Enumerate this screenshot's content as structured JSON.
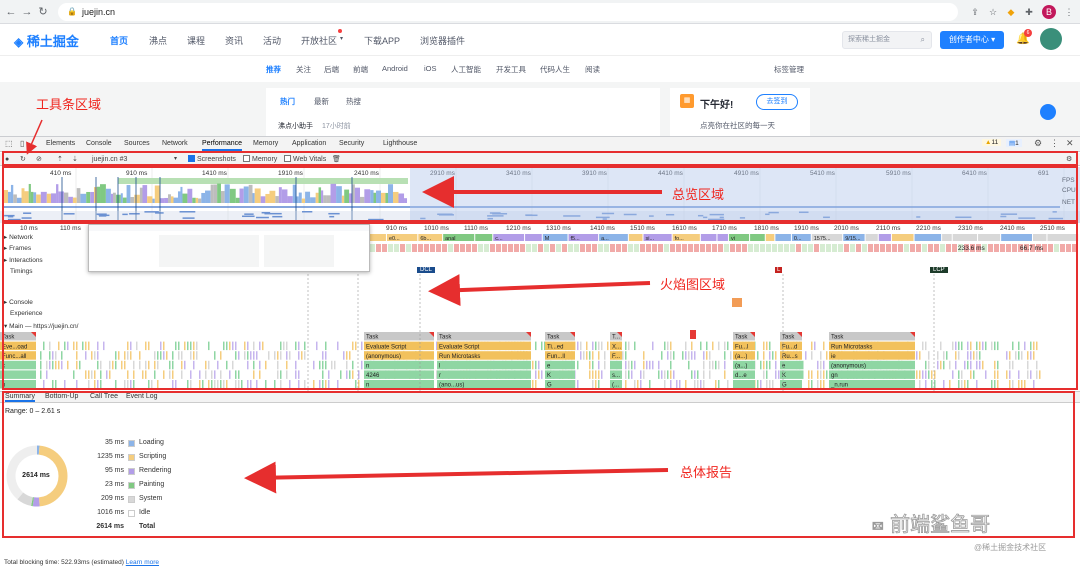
{
  "browser": {
    "url": "juejin.cn"
  },
  "site": {
    "logo": "稀土掘金",
    "nav": [
      "首页",
      "沸点",
      "课程",
      "资讯",
      "活动",
      "开放社区",
      "下载APP",
      "浏览器插件"
    ],
    "search_placeholder": "探索稀土掘金",
    "create_button": "创作者中心",
    "subnav": [
      "推荐",
      "关注",
      "后端",
      "前端",
      "Android",
      "iOS",
      "人工智能",
      "开发工具",
      "代码人生",
      "阅读"
    ],
    "tag_manage": "标签管理",
    "feed_tabs": [
      "热门",
      "最新",
      "热搜"
    ],
    "feed_author": "沸点小助手",
    "feed_time": "17小时前",
    "greeting": "下午好!",
    "checkin_button": "去签到",
    "greeting_sub": "点亮你在社区的每一天",
    "notification_count": "6"
  },
  "devtools": {
    "tabs": [
      "Elements",
      "Console",
      "Sources",
      "Network",
      "Performance",
      "Memory",
      "Application",
      "Security",
      "Lighthouse"
    ],
    "active_tab": "Performance",
    "warnings": "11",
    "messages": "1",
    "toolbar": {
      "profile_select": "juejin.cn #3",
      "screenshots": "Screenshots",
      "memory": "Memory",
      "web_vitals": "Web Vitals"
    },
    "overview": {
      "ticks": [
        "410 ms",
        "910 ms",
        "1410 ms",
        "1910 ms",
        "2410 ms",
        "2910 ms",
        "3410 ms",
        "3910 ms",
        "4410 ms",
        "4910 ms",
        "5410 ms",
        "5910 ms",
        "6410 ms",
        "691"
      ],
      "lanes": [
        "FPS",
        "CPU",
        "NET"
      ]
    },
    "flame": {
      "ticks": [
        "10 ms",
        "110 ms",
        "910 ms",
        "1010 ms",
        "1110 ms",
        "1210 ms",
        "1310 ms",
        "1410 ms",
        "1510 ms",
        "1610 ms",
        "1710 ms",
        "1810 ms",
        "1910 ms",
        "2010 ms",
        "2110 ms",
        "2210 ms",
        "2310 ms",
        "2410 ms",
        "2510 ms"
      ],
      "tracks": [
        "Network",
        "Frames",
        "Interactions",
        "Timings",
        "Console",
        "Experience",
        "Main — https://juejin.cn/"
      ],
      "frame_times": [
        "233.6 ms",
        "66.7 ms"
      ],
      "markers": [
        "DCL",
        "L",
        "LCP"
      ],
      "network_labels": [
        "e0...",
        "6b...",
        "anal",
        "c...",
        "M",
        "f5...",
        "a...",
        "si...",
        "fo...",
        "vi",
        "0...",
        "1575...",
        "9/15..."
      ],
      "main_rows": [
        [
          "Task",
          "Task",
          "Task",
          "Task",
          "T...",
          "Task",
          "Task",
          "Task"
        ],
        [
          "Eve...oad",
          "Evaluate Script",
          "Evaluate Script",
          "Ti...ed",
          "X...",
          "Fu...l",
          "Fu...d",
          "Run Microtasks"
        ],
        [
          "Func...all",
          "(anonymous)",
          "Run Microtasks",
          "Fun...ll",
          "F...",
          "(a...)",
          "Ru...s",
          "ie"
        ],
        [
          "c",
          "n",
          "l",
          "e",
          "",
          "(a...)",
          "e",
          "(anonymous)"
        ],
        [
          "f",
          "4246",
          "r",
          "K",
          "s...",
          "d...e",
          "K",
          "gn"
        ],
        [
          "n",
          "n",
          "(ano...us)",
          "G",
          "(...",
          "",
          "G",
          "_n.run"
        ]
      ]
    },
    "summary": {
      "tabs": [
        "Summary",
        "Bottom-Up",
        "Call Tree",
        "Event Log"
      ],
      "range": "Range: 0 – 2.61 s",
      "total_center": "2614 ms",
      "items": [
        {
          "value": "35 ms",
          "label": "Loading",
          "color": "#8cb4e8",
          "ms": 35
        },
        {
          "value": "1235 ms",
          "label": "Scripting",
          "color": "#f5cd7e",
          "ms": 1235
        },
        {
          "value": "95 ms",
          "label": "Rendering",
          "color": "#b29de8",
          "ms": 95
        },
        {
          "value": "23 ms",
          "label": "Painting",
          "color": "#80c982",
          "ms": 23
        },
        {
          "value": "209 ms",
          "label": "System",
          "color": "#d8d8d8",
          "ms": 209
        },
        {
          "value": "1016 ms",
          "label": "Idle",
          "color": "#ffffff",
          "ms": 1016
        }
      ],
      "total_value": "2614 ms",
      "total_label": "Total"
    },
    "status": "Total blocking time: 522.93ms (estimated)",
    "learn_more": "Learn more"
  },
  "annotations": {
    "toolbar": "工具条区域",
    "overview": "总览区域",
    "flame": "火焰图区域",
    "summary": "总体报告"
  },
  "watermark": {
    "title": "前端鲨鱼哥",
    "sub": "@稀土掘金技术社区"
  }
}
